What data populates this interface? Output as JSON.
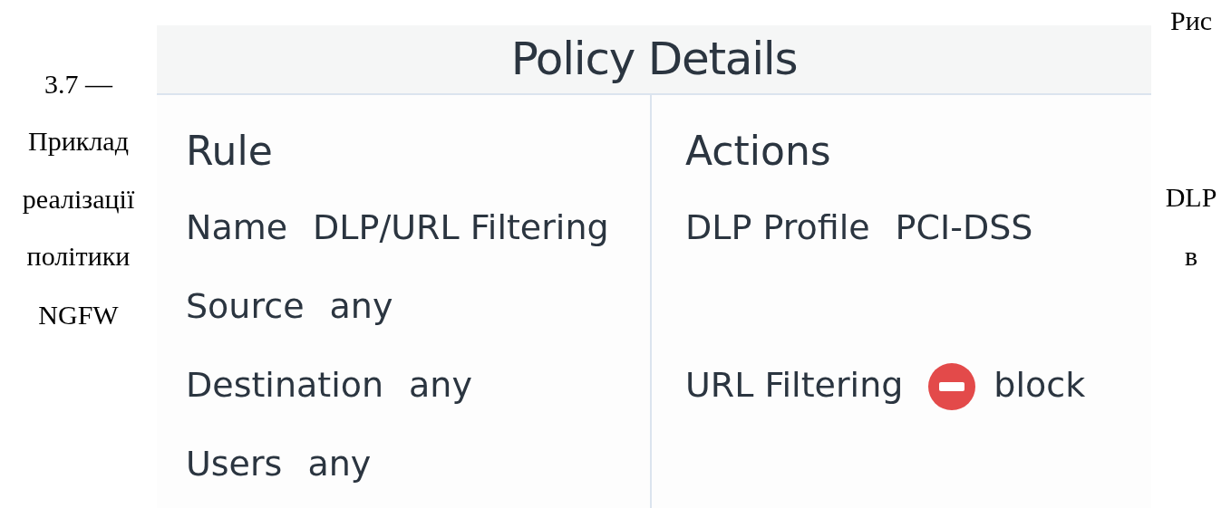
{
  "caption_left": [
    "3.7 —",
    "Приклад",
    "реалізації",
    "політики",
    "NGFW"
  ],
  "caption_right": [
    "Рис",
    "DLP",
    "в"
  ],
  "panel": {
    "title": "Policy Details",
    "rule_heading": "Rule",
    "actions_heading": "Actions",
    "rows": [
      {
        "kind": "plain",
        "rule_label": "Name",
        "rule_value": "DLP/URL Filtering",
        "action_label": "DLP Profile",
        "action_value": "PCI-DSS"
      },
      {
        "kind": "plain",
        "rule_label": "Source",
        "rule_value": "any"
      },
      {
        "kind": "blocked",
        "rule_label": "Destination",
        "rule_value": "any",
        "action_label": "URL Filtering",
        "action_value": "block"
      },
      {
        "kind": "plain",
        "rule_label": "Users",
        "rule_value": "any"
      }
    ]
  }
}
